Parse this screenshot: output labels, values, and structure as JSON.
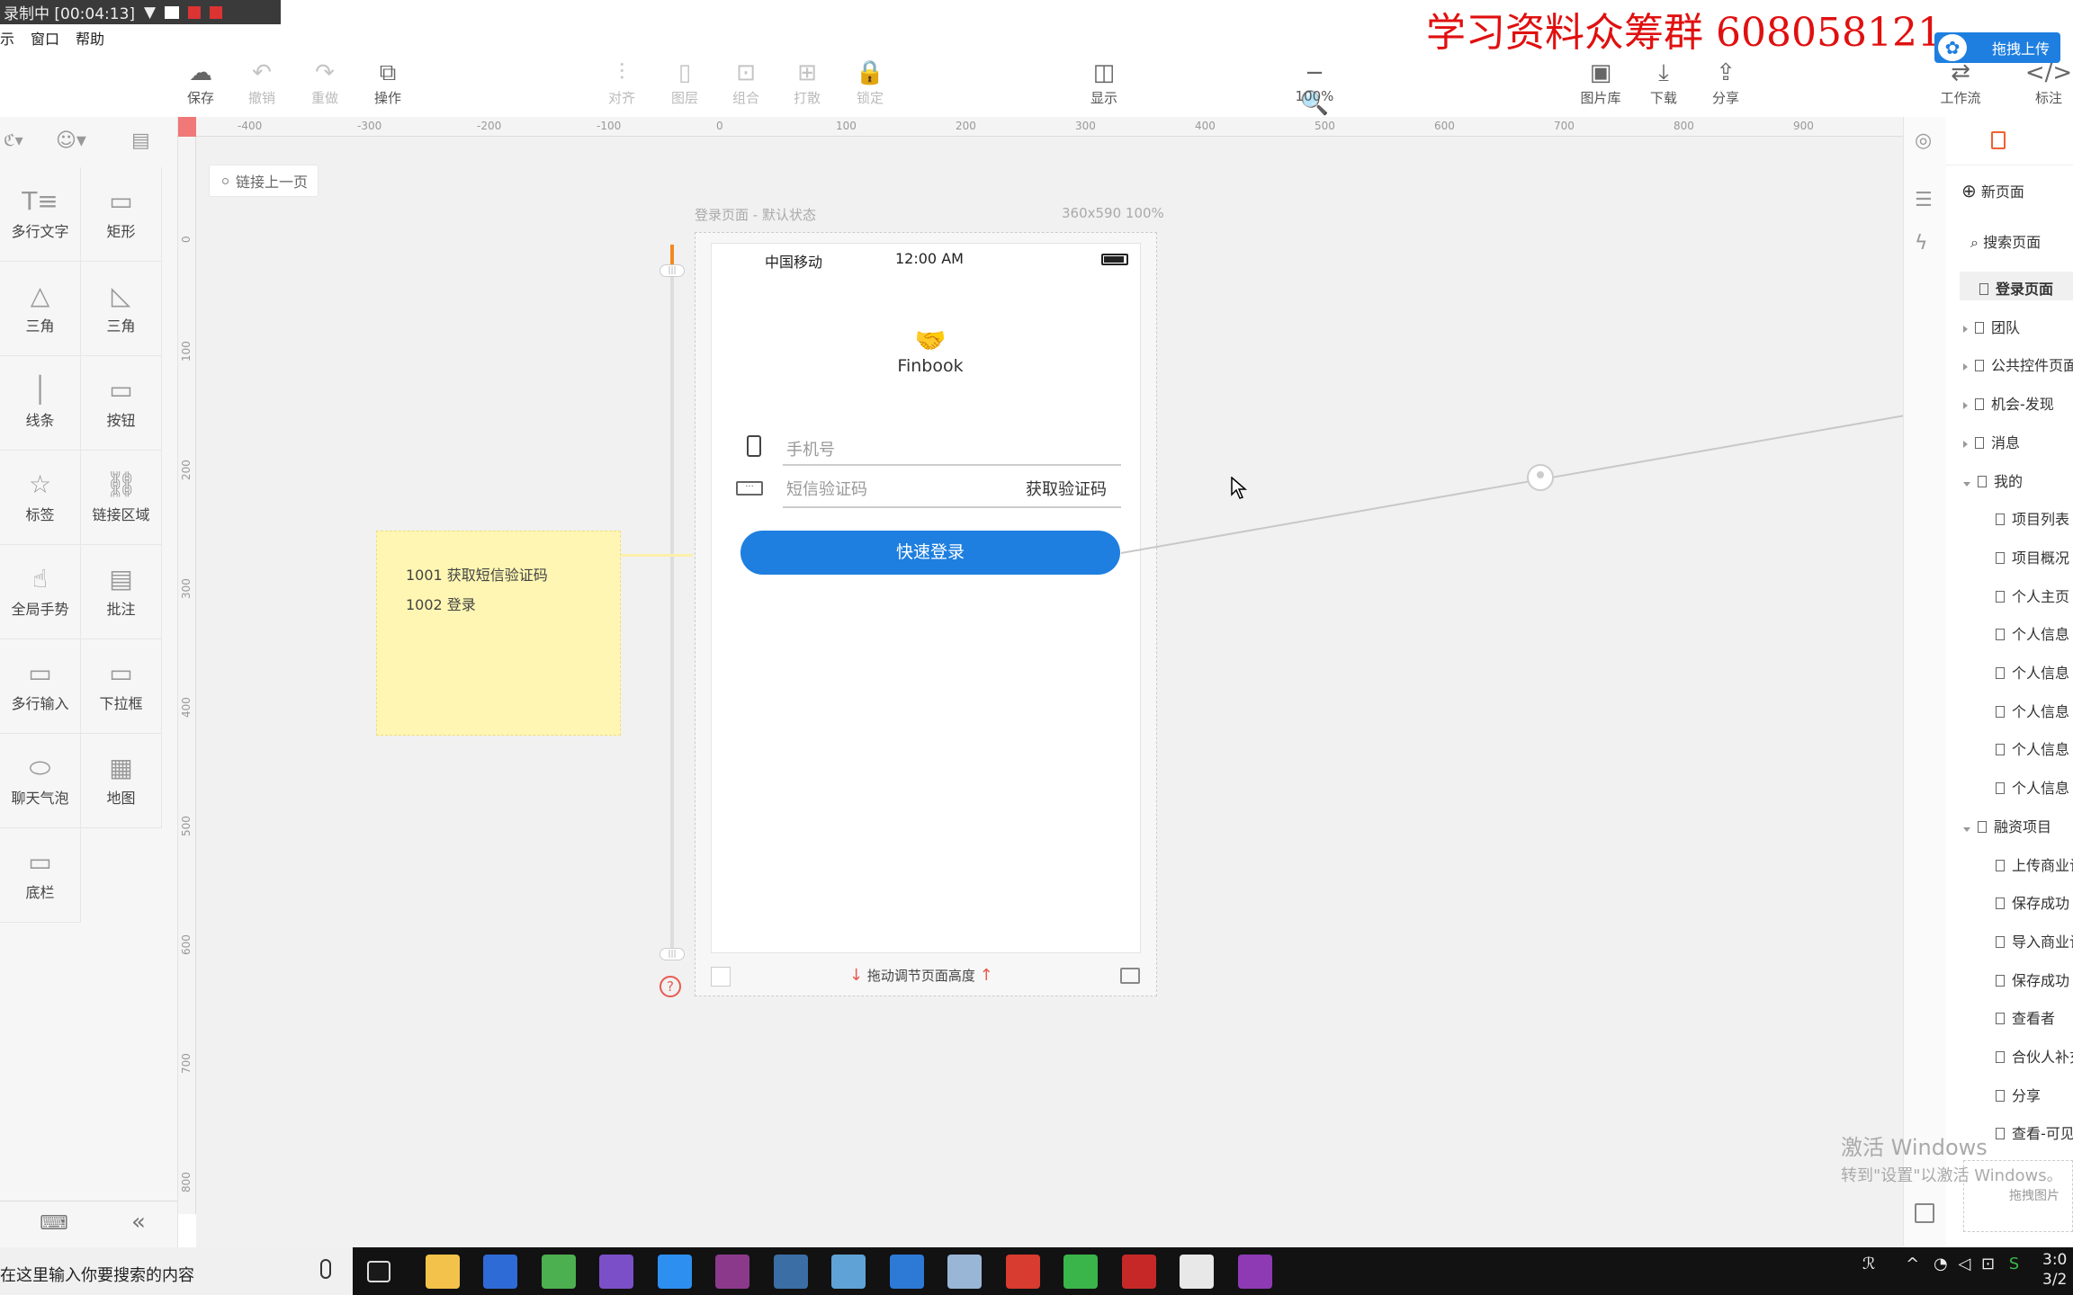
{
  "recorder": {
    "label": "录制中 [00:04:13]"
  },
  "menu": {
    "items": [
      "示",
      "窗口",
      "帮助"
    ]
  },
  "watermark": "学习资料众筹群  608058121",
  "upload_button": "拖拽上传",
  "toolbar": {
    "save": "保存",
    "undo": "撤销",
    "redo": "重做",
    "ops": "操作",
    "align": "对齐",
    "layer": "图层",
    "group": "组合",
    "ungroup": "打散",
    "lock": "锁定",
    "display": "显示",
    "zoom": "100%",
    "zoom_minus": "−",
    "zoom_plus": "+",
    "gallery": "图片库",
    "download": "下载",
    "share": "分享",
    "workflow": "工作流",
    "annotate": "标注"
  },
  "ruler": {
    "h_ticks": [
      "-400",
      "-300",
      "-200",
      "-100",
      "0",
      "100",
      "200",
      "300",
      "400",
      "500",
      "600",
      "700",
      "800",
      "900"
    ],
    "v_ticks": [
      "0",
      "100",
      "200",
      "300",
      "400",
      "500",
      "600",
      "700",
      "800"
    ]
  },
  "components": [
    {
      "label": "多行文字",
      "icon": "multiline-text-icon",
      "glyph": "T≡"
    },
    {
      "label": "矩形",
      "icon": "rectangle-icon",
      "glyph": "▭"
    },
    {
      "label": "三角",
      "icon": "triangle-icon",
      "glyph": "△"
    },
    {
      "label": "三角",
      "icon": "right-triangle-icon",
      "glyph": "◺"
    },
    {
      "label": "线条",
      "icon": "line-icon",
      "glyph": "│"
    },
    {
      "label": "按钮",
      "icon": "button-icon",
      "glyph": "▭"
    },
    {
      "label": "标签",
      "icon": "star-icon",
      "glyph": "☆"
    },
    {
      "label": "链接区域",
      "icon": "link-area-icon",
      "glyph": "⛓"
    },
    {
      "label": "全局手势",
      "icon": "gesture-icon",
      "glyph": "☝"
    },
    {
      "label": "批注",
      "icon": "annotation-icon",
      "glyph": "▤"
    },
    {
      "label": "多行输入",
      "icon": "multiline-input-icon",
      "glyph": "▭"
    },
    {
      "label": "下拉框",
      "icon": "dropdown-icon",
      "glyph": "▭"
    },
    {
      "label": "聊天气泡",
      "icon": "chat-bubble-icon",
      "glyph": "⬭"
    },
    {
      "label": "地图",
      "icon": "map-icon",
      "glyph": "▦"
    },
    {
      "label": "底栏",
      "icon": "tabbar-icon",
      "glyph": "▭"
    }
  ],
  "canvas": {
    "link_prev": "链接上一页",
    "page_label": "登录页面 - 默认状态",
    "page_size": "360x590 100%",
    "drag_hint": "拖动调节页面高度"
  },
  "phone": {
    "carrier": "中国移动",
    "time": "12:00 AM",
    "brand": "Finbook",
    "phone_placeholder": "手机号",
    "code_placeholder": "短信验证码",
    "get_code": "获取验证码",
    "login_button": "快速登录"
  },
  "sticky": {
    "lines": [
      "1001 获取短信验证码",
      "1002 登录"
    ]
  },
  "pages_panel": {
    "new_page": "新页面",
    "search": "搜索页面",
    "items": [
      {
        "label": "登录页面",
        "level": 0,
        "arrow": "none",
        "active": true
      },
      {
        "label": "团队",
        "level": 0,
        "arrow": "closed"
      },
      {
        "label": "公共控件页面",
        "level": 0,
        "arrow": "closed"
      },
      {
        "label": "机会-发现",
        "level": 0,
        "arrow": "closed"
      },
      {
        "label": "消息",
        "level": 0,
        "arrow": "closed"
      },
      {
        "label": "我的",
        "level": 0,
        "arrow": "open"
      },
      {
        "label": "项目列表",
        "level": 1
      },
      {
        "label": "项目概况",
        "level": 1
      },
      {
        "label": "个人主页",
        "level": 1
      },
      {
        "label": "个人信息",
        "level": 1
      },
      {
        "label": "个人信息",
        "level": 1
      },
      {
        "label": "个人信息",
        "level": 1
      },
      {
        "label": "个人信息",
        "level": 1
      },
      {
        "label": "个人信息",
        "level": 1
      },
      {
        "label": "融资项目",
        "level": 0,
        "arrow": "open"
      },
      {
        "label": "上传商业计",
        "level": 1
      },
      {
        "label": "保存成功",
        "level": 1
      },
      {
        "label": "导入商业计",
        "level": 1
      },
      {
        "label": "保存成功",
        "level": 1
      },
      {
        "label": "查看者",
        "level": 1
      },
      {
        "label": "合伙人补充",
        "level": 1
      },
      {
        "label": "分享",
        "level": 1
      },
      {
        "label": "查看-可见",
        "level": 1
      }
    ],
    "drop_hint": "拖拽图片"
  },
  "windows_activation": {
    "title": "激活 Windows",
    "subtitle": "转到\"设置\"以激活 Windows。"
  },
  "taskbar": {
    "search_placeholder": "在这里输入你要搜索的内容",
    "tray_time": "3:0",
    "tray_date": "3/2",
    "apps": [
      {
        "name": "taskview",
        "color": "#1a1a1a"
      },
      {
        "name": "explorer",
        "color": "#f3c24a"
      },
      {
        "name": "feishu",
        "color": "#2f6bd6"
      },
      {
        "name": "chrome",
        "color": "#4caf50"
      },
      {
        "name": "visual-studio",
        "color": "#7b4fc8"
      },
      {
        "name": "app-blue",
        "color": "#2d8ff0"
      },
      {
        "name": "winrar",
        "color": "#8b3a8b"
      },
      {
        "name": "app-window",
        "color": "#3a6ea5"
      },
      {
        "name": "notepad",
        "color": "#5fa3d6"
      },
      {
        "name": "vscode",
        "color": "#2c7ad6"
      },
      {
        "name": "app-cloud",
        "color": "#9ab6d6"
      },
      {
        "name": "youdao",
        "color": "#d83b2f"
      },
      {
        "name": "wechat",
        "color": "#3ab54a"
      },
      {
        "name": "recorder",
        "color": "#c62828"
      },
      {
        "name": "mockplus",
        "color": "#e8e8e8"
      },
      {
        "name": "axure-rp",
        "color": "#8e3ab5"
      }
    ]
  }
}
